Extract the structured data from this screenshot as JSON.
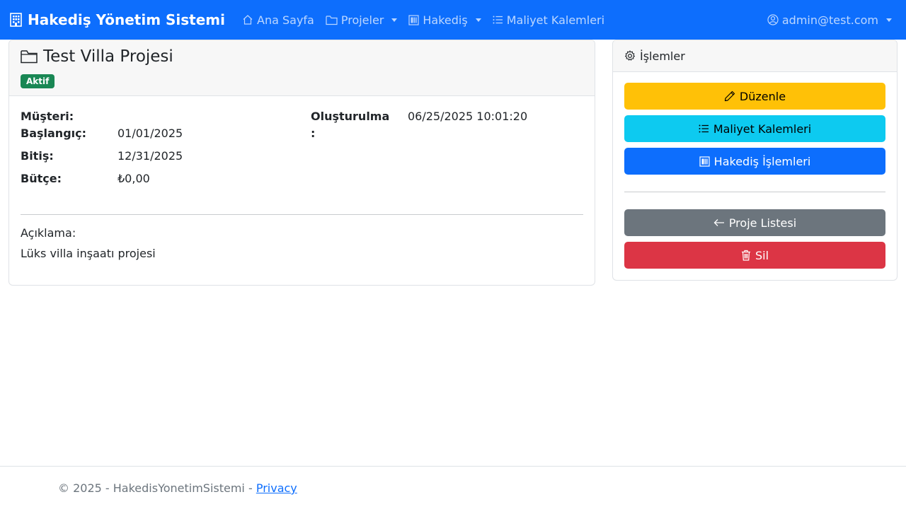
{
  "navbar": {
    "brand": "Hakediş Yönetim Sistemi",
    "brand_icon": "building-icon",
    "items": [
      {
        "label": "Ana Sayfa",
        "icon": "house-icon",
        "dropdown": false
      },
      {
        "label": "Projeler",
        "icon": "folder-icon",
        "dropdown": true
      },
      {
        "label": "Hakediş",
        "icon": "receipt-icon",
        "dropdown": true
      },
      {
        "label": "Maliyet Kalemleri",
        "icon": "list-icon",
        "dropdown": false
      }
    ],
    "user": "admin@test.com",
    "user_icon": "person-circle-icon",
    "bg_color": "#0d6efd"
  },
  "project": {
    "title": "Test Villa Projesi",
    "status": "Aktif",
    "status_color": "#198754",
    "customer_label": "Müşteri:",
    "customer_value": "",
    "start_label": "Başlangıç:",
    "start_value": "01/01/2025",
    "end_label": "Bitiş:",
    "end_value": "12/31/2025",
    "budget_label": "Bütçe:",
    "budget_value": "₺0,00",
    "created_label_line1": "Oluşturulma",
    "created_label_line2": ":",
    "created_value": "06/25/2025 10:01:20",
    "description_label": "Açıklama:",
    "description": "Lüks villa inşaatı projesi"
  },
  "actions": {
    "header": "İşlemler",
    "edit": "Düzenle",
    "cost_items": "Maliyet Kalemleri",
    "progress_ops": "Hakediş İşlemleri",
    "project_list": "Proje Listesi",
    "delete": "Sil"
  },
  "footer": {
    "text": "© 2025 - HakedisYonetimSistemi - ",
    "privacy": "Privacy"
  }
}
